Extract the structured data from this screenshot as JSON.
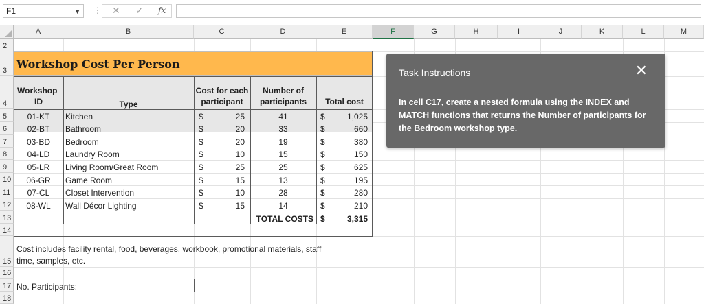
{
  "formula_bar": {
    "name_box": "F1",
    "cancel_icon": "✕",
    "enter_icon": "✓",
    "fx_label": "fx",
    "formula": ""
  },
  "columns": [
    "A",
    "B",
    "C",
    "D",
    "E",
    "F",
    "G",
    "H",
    "I",
    "J",
    "K",
    "L",
    "M"
  ],
  "rows": [
    "2",
    "3",
    "4",
    "5",
    "6",
    "7",
    "8",
    "9",
    "10",
    "11",
    "12",
    "13",
    "14",
    "15",
    "16",
    "17",
    "18"
  ],
  "sheet": {
    "title": "Workshop Cost Per Person",
    "headers": {
      "id_line1": "Workshop",
      "id_line2": "ID",
      "type": "Type",
      "cost_line1": "Cost for each",
      "cost_line2": "participant",
      "num_line1": "Number of",
      "num_line2": "participants",
      "total": "Total cost"
    },
    "data_rows": [
      {
        "id": "01-KT",
        "type": "Kitchen",
        "cur": "$",
        "cost": "25",
        "num": "41",
        "tcur": "$",
        "total": "1,025"
      },
      {
        "id": "02-BT",
        "type": "Bathroom",
        "cur": "$",
        "cost": "20",
        "num": "33",
        "tcur": "$",
        "total": "660"
      },
      {
        "id": "03-BD",
        "type": "Bedroom",
        "cur": "$",
        "cost": "20",
        "num": "19",
        "tcur": "$",
        "total": "380"
      },
      {
        "id": "04-LD",
        "type": "Laundry Room",
        "cur": "$",
        "cost": "10",
        "num": "15",
        "tcur": "$",
        "total": "150"
      },
      {
        "id": "05-LR",
        "type": "Living Room/Great Room",
        "cur": "$",
        "cost": "25",
        "num": "25",
        "tcur": "$",
        "total": "625"
      },
      {
        "id": "06-GR",
        "type": "Game Room",
        "cur": "$",
        "cost": "15",
        "num": "13",
        "tcur": "$",
        "total": "195"
      },
      {
        "id": "07-CL",
        "type": "Closet Intervention",
        "cur": "$",
        "cost": "10",
        "num": "28",
        "tcur": "$",
        "total": "280"
      },
      {
        "id": "08-WL",
        "type": "Wall Décor Lighting",
        "cur": "$",
        "cost": "15",
        "num": "14",
        "tcur": "$",
        "total": "210"
      }
    ],
    "total_label": "TOTAL COSTS",
    "total_cur": "$",
    "total_value": "3,315",
    "note_line1": "Cost includes facility rental, food, beverages, workbook, promotional materials, staff",
    "note_line2": "time, samples, etc.",
    "participants_label": "No. Participants:"
  },
  "task_panel": {
    "title": "Task Instructions",
    "close_icon": "✕",
    "body": "In cell C17, create a nested formula using the INDEX and MATCH functions that returns the Number of participants for the Bedroom workshop type."
  },
  "colors": {
    "title_fill": "#ffb84d",
    "header_fill": "#e7e7e7",
    "task_bg": "#686868",
    "selected_col": "#217346"
  }
}
